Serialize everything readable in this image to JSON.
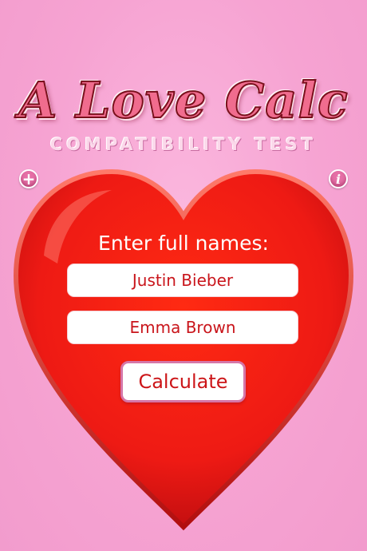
{
  "header": {
    "title": "A Love Calc",
    "subtitle": "COMPATIBILITY TEST"
  },
  "toolbar": {
    "add_icon": "plus-icon",
    "add_glyph": "+",
    "info_icon": "info-icon",
    "info_glyph": "i"
  },
  "form": {
    "prompt": "Enter full names:",
    "name1": "Justin Bieber",
    "name2": "Emma Brown",
    "calculate_label": "Calculate"
  },
  "colors": {
    "background": "#f7a6d4",
    "heart": "#ee1a14",
    "heart_shadow": "#b10e0e",
    "text_red": "#c9151b",
    "button_border": "#d676a8"
  }
}
